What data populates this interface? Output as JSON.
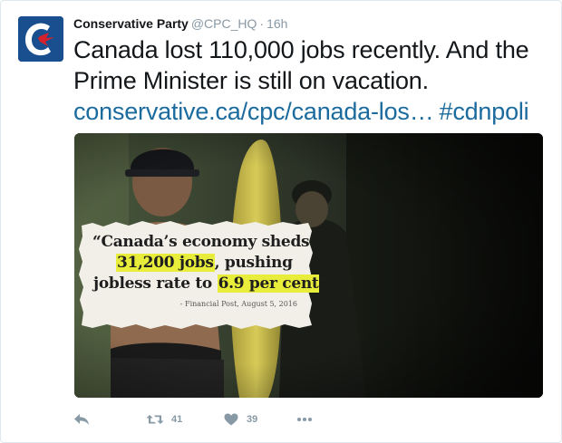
{
  "tweet": {
    "display_name": "Conservative Party",
    "username": "@CPC_HQ",
    "separator": "·",
    "timestamp": "16h",
    "text": "Canada lost 110,000 jobs recently. And the Prime Minister is still on vacation.",
    "link": "conservative.ca/cpc/canada-los…",
    "hashtag": "#cdnpoli"
  },
  "media": {
    "clipping_line1": "“Canada’s economy sheds",
    "clipping_line2_highlight": "31,200 jobs",
    "clipping_line2_rest": ", pushing",
    "clipping_line3_prefix": "jobless rate to ",
    "clipping_line3_highlight": "6.9 per cent",
    "clipping_line3_suffix": "”",
    "clipping_source": "- Financial Post, August 5, 2016",
    "highlight_color": "#e8ec3a"
  },
  "actions": {
    "reply_icon": "reply-icon",
    "retweet_icon": "retweet-icon",
    "retweet_count": "41",
    "like_icon": "heart-icon",
    "like_count": "39",
    "more_icon": "more-icon"
  },
  "colors": {
    "link": "#1b6b9e",
    "muted": "#8899a6",
    "avatar_bg": "#1a4f8f",
    "accent_red": "#d6202b"
  }
}
